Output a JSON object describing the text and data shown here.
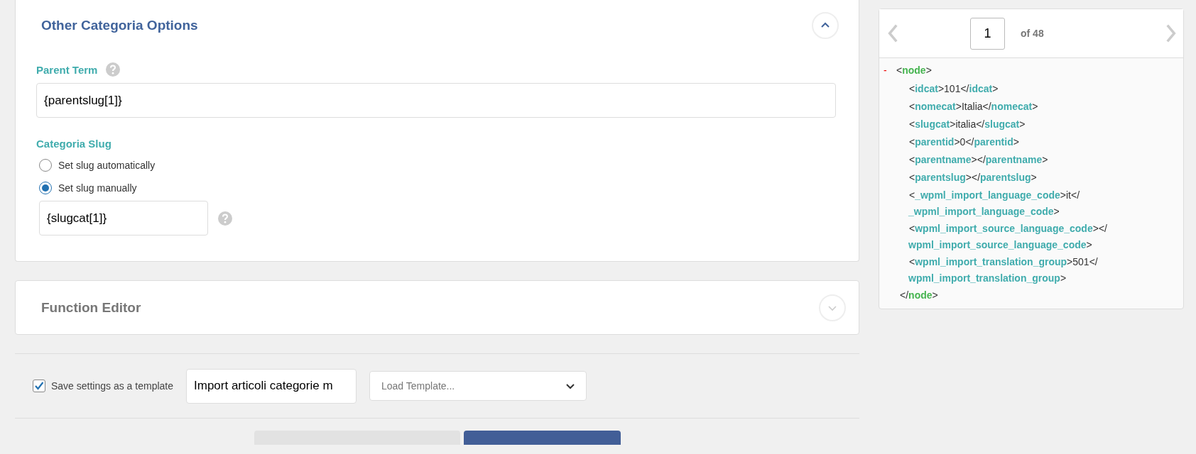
{
  "options_panel": {
    "title": "Other Categoria Options",
    "expanded": true,
    "parent_term": {
      "label": "Parent Term",
      "value": "{parentslug[1]}"
    },
    "slug": {
      "label": "Categoria Slug",
      "options": [
        {
          "label": "Set slug automatically",
          "selected": false
        },
        {
          "label": "Set slug manually",
          "selected": true
        }
      ],
      "value": "{slugcat[1]}"
    }
  },
  "function_editor": {
    "title": "Function Editor",
    "expanded": false
  },
  "template": {
    "save_label": "Save settings as a template",
    "checked": true,
    "name": "Import articoli categorie m",
    "load_placeholder": "Load Template..."
  },
  "preview": {
    "page": "1",
    "of": "of 48",
    "toggle": "-",
    "lines": [
      {
        "kind": "root",
        "text": "<node>"
      },
      {
        "kind": "child",
        "text": "<idcat>101</idcat>"
      },
      {
        "kind": "child",
        "text": "<nomecat>Italia</nomecat>"
      },
      {
        "kind": "child",
        "text": "<slugcat>italia</slugcat>"
      },
      {
        "kind": "child",
        "text": "<parentid>0</parentid>"
      },
      {
        "kind": "child",
        "text": "<parentname></parentname>"
      },
      {
        "kind": "child",
        "text": "<parentslug></parentslug>"
      },
      {
        "kind": "child",
        "text": "<_wpml_import_language_code>it</"
      },
      {
        "kind": "wrap",
        "text": "_wpml_import_language_code>"
      },
      {
        "kind": "child",
        "text": "<wpml_import_source_language_code></"
      },
      {
        "kind": "wrap",
        "text": "wpml_import_source_language_code>"
      },
      {
        "kind": "child",
        "text": "<wpml_import_translation_group>501</"
      },
      {
        "kind": "wrap",
        "text": "wpml_import_translation_group>"
      },
      {
        "kind": "root_end",
        "text": "</node>"
      }
    ]
  }
}
